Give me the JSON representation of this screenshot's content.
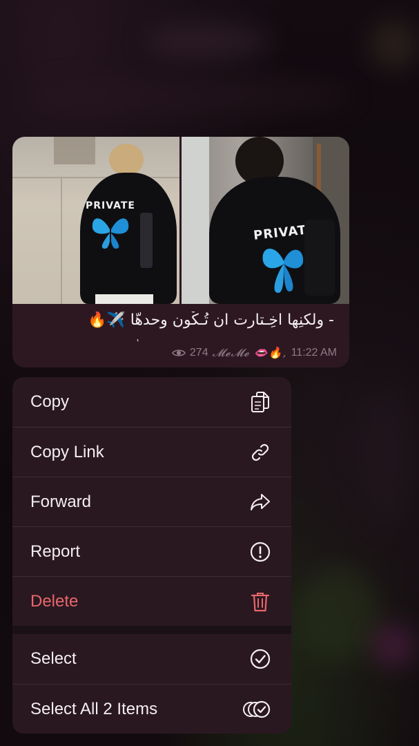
{
  "message": {
    "caption": "- ولكنِها اخِـتارت ان تُـكْون وحدهّا ✈️🔥",
    "caption_tail": "'",
    "views": "274",
    "signature": "𝓜𝓮𝓜𝓮 👄🔥,",
    "time": "11:22 AM",
    "photo_left_print": "PRIVATE",
    "photo_right_print": "PRIVATE"
  },
  "menu": {
    "items": [
      {
        "label": "Copy",
        "icon": "copy-icon"
      },
      {
        "label": "Copy Link",
        "icon": "link-icon"
      },
      {
        "label": "Forward",
        "icon": "forward-icon"
      },
      {
        "label": "Report",
        "icon": "report-icon"
      },
      {
        "label": "Delete",
        "icon": "trash-icon"
      },
      {
        "label": "Select",
        "icon": "check-circle-icon"
      },
      {
        "label": "Select All 2 Items",
        "icon": "multi-check-icon"
      }
    ]
  },
  "colors": {
    "danger": "#e8676a",
    "menu_bg": "#2a1821",
    "bubble_bg": "#2d1822"
  }
}
